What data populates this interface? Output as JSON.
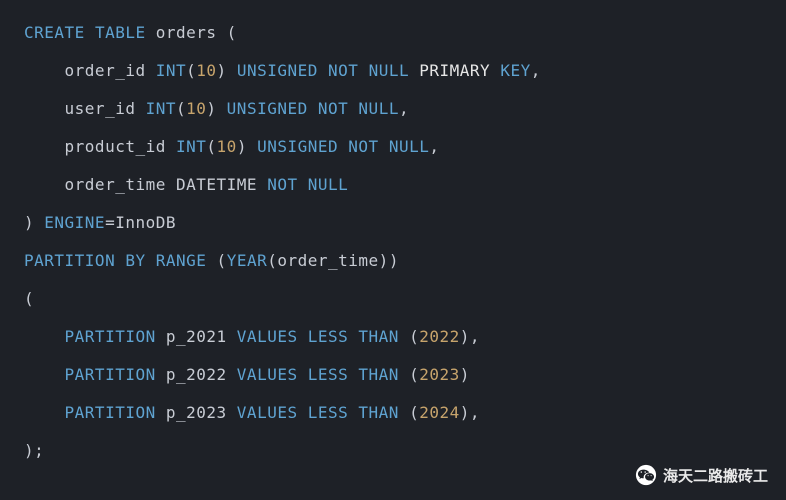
{
  "code": {
    "lines": [
      {
        "tokens": [
          {
            "c": "kw",
            "t": "CREATE"
          },
          {
            "c": "id",
            "t": " "
          },
          {
            "c": "kw",
            "t": "TABLE"
          },
          {
            "c": "id",
            "t": " orders ("
          }
        ]
      },
      {
        "tokens": [
          {
            "c": "id",
            "t": "    order_id "
          },
          {
            "c": "kw",
            "t": "INT"
          },
          {
            "c": "id",
            "t": "("
          },
          {
            "c": "num",
            "t": "10"
          },
          {
            "c": "id",
            "t": ") "
          },
          {
            "c": "kw",
            "t": "UNSIGNED"
          },
          {
            "c": "id",
            "t": " "
          },
          {
            "c": "kw",
            "t": "NOT"
          },
          {
            "c": "id",
            "t": " "
          },
          {
            "c": "kw",
            "t": "NULL"
          },
          {
            "c": "id",
            "t": " "
          },
          {
            "c": "white",
            "t": "PRIMARY"
          },
          {
            "c": "id",
            "t": " "
          },
          {
            "c": "kw",
            "t": "KEY"
          },
          {
            "c": "id",
            "t": ","
          }
        ]
      },
      {
        "tokens": [
          {
            "c": "id",
            "t": "    user_id "
          },
          {
            "c": "kw",
            "t": "INT"
          },
          {
            "c": "id",
            "t": "("
          },
          {
            "c": "num",
            "t": "10"
          },
          {
            "c": "id",
            "t": ") "
          },
          {
            "c": "kw",
            "t": "UNSIGNED"
          },
          {
            "c": "id",
            "t": " "
          },
          {
            "c": "kw",
            "t": "NOT"
          },
          {
            "c": "id",
            "t": " "
          },
          {
            "c": "kw",
            "t": "NULL"
          },
          {
            "c": "id",
            "t": ","
          }
        ]
      },
      {
        "tokens": [
          {
            "c": "id",
            "t": "    product_id "
          },
          {
            "c": "kw",
            "t": "INT"
          },
          {
            "c": "id",
            "t": "("
          },
          {
            "c": "num",
            "t": "10"
          },
          {
            "c": "id",
            "t": ") "
          },
          {
            "c": "kw",
            "t": "UNSIGNED"
          },
          {
            "c": "id",
            "t": " "
          },
          {
            "c": "kw",
            "t": "NOT"
          },
          {
            "c": "id",
            "t": " "
          },
          {
            "c": "kw",
            "t": "NULL"
          },
          {
            "c": "id",
            "t": ","
          }
        ]
      },
      {
        "tokens": [
          {
            "c": "id",
            "t": "    order_time DATETIME "
          },
          {
            "c": "kw",
            "t": "NOT"
          },
          {
            "c": "id",
            "t": " "
          },
          {
            "c": "kw",
            "t": "NULL"
          }
        ]
      },
      {
        "tokens": [
          {
            "c": "id",
            "t": ") "
          },
          {
            "c": "kw",
            "t": "ENGINE"
          },
          {
            "c": "id",
            "t": "="
          },
          {
            "c": "id",
            "t": "InnoDB"
          }
        ]
      },
      {
        "tokens": [
          {
            "c": "kw",
            "t": "PARTITION"
          },
          {
            "c": "id",
            "t": " "
          },
          {
            "c": "kw",
            "t": "BY"
          },
          {
            "c": "id",
            "t": " "
          },
          {
            "c": "kw",
            "t": "RANGE"
          },
          {
            "c": "id",
            "t": " ("
          },
          {
            "c": "fn",
            "t": "YEAR"
          },
          {
            "c": "id",
            "t": "(order_time))"
          }
        ]
      },
      {
        "tokens": [
          {
            "c": "id",
            "t": "("
          }
        ]
      },
      {
        "tokens": [
          {
            "c": "id",
            "t": "    "
          },
          {
            "c": "kw",
            "t": "PARTITION"
          },
          {
            "c": "id",
            "t": " p_2021 "
          },
          {
            "c": "kw",
            "t": "VALUES"
          },
          {
            "c": "id",
            "t": " "
          },
          {
            "c": "kw",
            "t": "LESS"
          },
          {
            "c": "id",
            "t": " "
          },
          {
            "c": "kw",
            "t": "THAN"
          },
          {
            "c": "id",
            "t": " ("
          },
          {
            "c": "num",
            "t": "2022"
          },
          {
            "c": "id",
            "t": "),"
          }
        ]
      },
      {
        "tokens": [
          {
            "c": "id",
            "t": "    "
          },
          {
            "c": "kw",
            "t": "PARTITION"
          },
          {
            "c": "id",
            "t": " p_2022 "
          },
          {
            "c": "kw",
            "t": "VALUES"
          },
          {
            "c": "id",
            "t": " "
          },
          {
            "c": "kw",
            "t": "LESS"
          },
          {
            "c": "id",
            "t": " "
          },
          {
            "c": "kw",
            "t": "THAN"
          },
          {
            "c": "id",
            "t": " ("
          },
          {
            "c": "num",
            "t": "2023"
          },
          {
            "c": "id",
            "t": ")"
          }
        ]
      },
      {
        "tokens": [
          {
            "c": "id",
            "t": "    "
          },
          {
            "c": "kw",
            "t": "PARTITION"
          },
          {
            "c": "id",
            "t": " p_2023 "
          },
          {
            "c": "kw",
            "t": "VALUES"
          },
          {
            "c": "id",
            "t": " "
          },
          {
            "c": "kw",
            "t": "LESS"
          },
          {
            "c": "id",
            "t": " "
          },
          {
            "c": "kw",
            "t": "THAN"
          },
          {
            "c": "id",
            "t": " ("
          },
          {
            "c": "num",
            "t": "2024"
          },
          {
            "c": "id",
            "t": "),"
          }
        ]
      },
      {
        "tokens": [
          {
            "c": "id",
            "t": ");"
          }
        ]
      }
    ]
  },
  "watermark": {
    "text": "海天二路搬砖工",
    "icon": "wechat-icon"
  }
}
